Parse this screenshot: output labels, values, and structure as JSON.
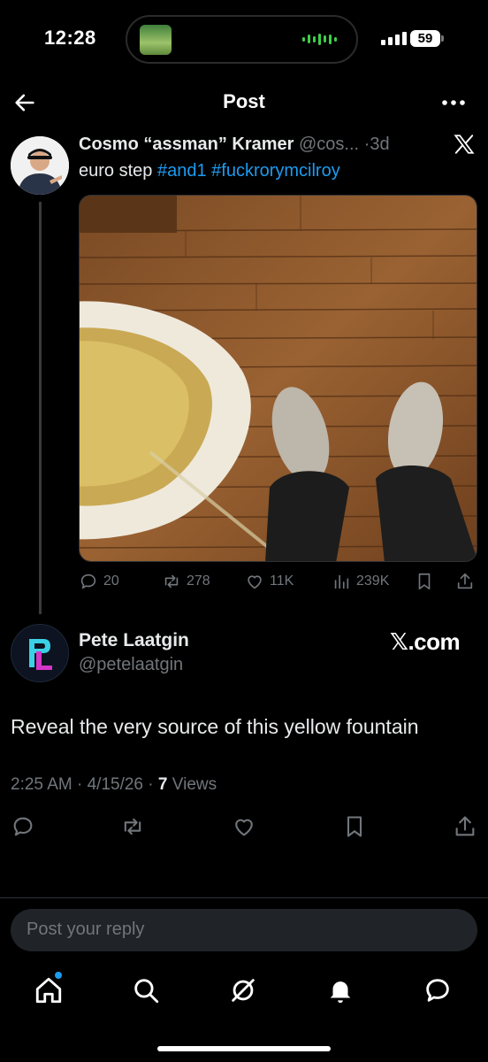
{
  "status_bar": {
    "time": "12:28",
    "battery": "59"
  },
  "header": {
    "title": "Post"
  },
  "quoted_post": {
    "name": "Cosmo “assman” Kramer",
    "handle": "@cos...",
    "separator": "·",
    "age": "3d",
    "text": "euro step",
    "hashtags": [
      "#and1",
      "#fuckrorymcilroy"
    ],
    "stats": {
      "replies": "20",
      "reposts": "278",
      "likes": "11K",
      "views": "239K"
    }
  },
  "main_post": {
    "name": "Pete Laatgin",
    "handle": "@petelaatgin",
    "brand": "𝕏.com",
    "text": "Reveal the very source of this yellow fountain",
    "time": "2:25 AM",
    "date": "4/15/26",
    "views_count": "7",
    "views_label": "Views"
  },
  "reply": {
    "placeholder": "Post your reply"
  },
  "colors": {
    "accent": "#1d9bf0",
    "muted": "#71767b",
    "text": "#e7e9ea",
    "background": "#000000"
  },
  "tabs": [
    "home-icon",
    "search-icon",
    "grok-icon",
    "notifications-icon",
    "messages-icon"
  ]
}
